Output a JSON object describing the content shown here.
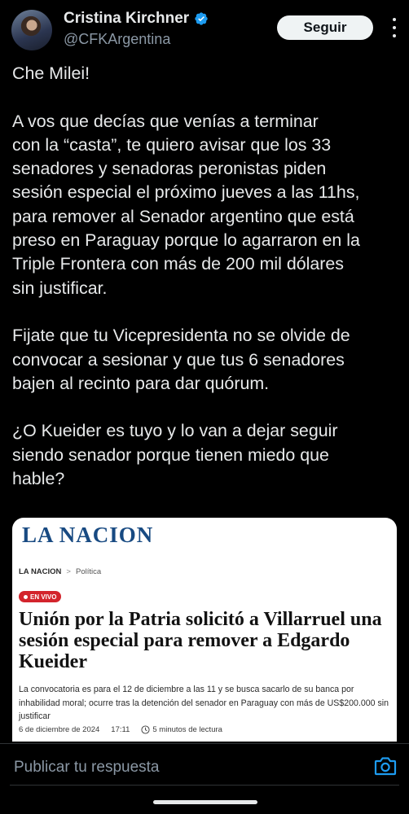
{
  "author": {
    "name": "Cristina Kirchner",
    "handle": "@CFKArgentina",
    "verified_color": "#1d9bf0"
  },
  "actions": {
    "follow_label": "Seguir"
  },
  "tweet": {
    "paragraphs": [
      "Che Milei!",
      "A vos que decías que venías a terminar\ncon la “casta”, te quiero avisar que los 33\nsenadores y senadoras peronistas piden\nsesión especial el próximo jueves a las 11hs,\npara remover al Senador argentino que está\npreso en Paraguay porque lo agarraron en la\nTriple Frontera con más de 200 mil dólares\nsin justificar.",
      "Fijate que tu Vicepresidenta no se olvide de\nconvocar a sesionar y que tus 6 senadores\nbajen al recinto para dar quórum.",
      "¿O Kueider es tuyo y lo van a dejar seguir\nsiendo senador porque tienen miedo que\nhable?"
    ]
  },
  "card": {
    "logo": "LA NACION",
    "breadcrumb_root": "LA NACION",
    "breadcrumb_sep": ">",
    "breadcrumb_section": "Política",
    "live_label": "EN VIVO",
    "headline": "Unión por la Patria solicitó a Villarruel una sesión especial para remover a Edgardo Kueider",
    "summary": "La convocatoria es para el 12 de diciembre a las 11 y se busca sacarlo de su banca por inhabilidad moral; ocurre tras la detención del senador en Paraguay con más de US$200.000 sin justificar",
    "date": "6 de diciembre de 2024",
    "time": "17:11",
    "reading_time": "5 minutos de lectura",
    "brand_color": "#184a82",
    "live_color": "#d3242c"
  },
  "reply": {
    "placeholder": "Publicar tu respuesta",
    "camera_icon_color": "#1d9bf0"
  }
}
